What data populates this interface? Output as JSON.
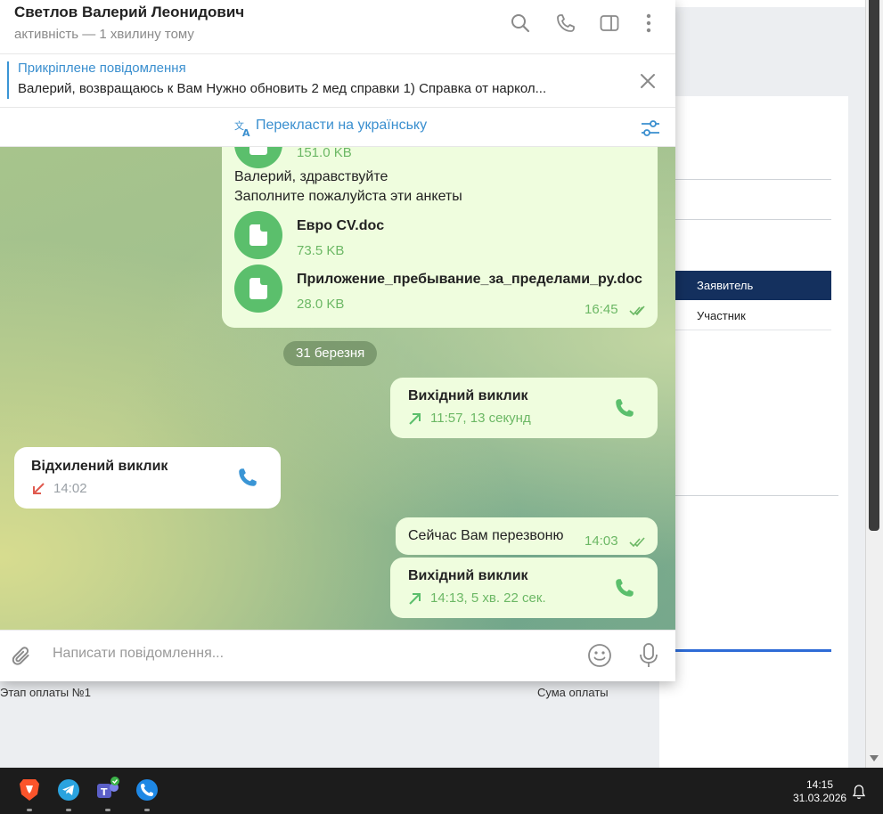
{
  "background_app": {
    "header_col": "Заявитель",
    "row_value": "Участник",
    "label_stage": "Этап оплаты №1",
    "label_sum": "Сума оплаты"
  },
  "telegram": {
    "contact_name": "Светлов Валерий Леонидович",
    "contact_status": "активність — 1 хвилину тому",
    "pinned_title": "Прикріплене повідомлення",
    "pinned_text": "Валерий, возвращаюсь к Вам  Нужно обновить 2 мед справки 1) Справка от наркол...",
    "translate_label": "Перекласти на українську",
    "messages": {
      "partial_file_size": "151.0 KB",
      "greeting_line1": "Валерий, здравствуйте",
      "greeting_line2": "Заполните пожалуйста эти анкеты",
      "file1_name": "Евро CV.doc",
      "file1_size": "73.5 KB",
      "file2_name": "Приложение_пребывание_за_пределами_ру.doc",
      "file2_size": "28.0 KB",
      "file_msg_time": "16:45",
      "date_divider": "31 березня",
      "call1_title": "Вихідний виклик",
      "call1_detail": "11:57, 13 секунд",
      "call2_title": "Відхилений виклик",
      "call2_detail": "14:02",
      "text_msg": "Сейчас Вам перезвоню",
      "text_msg_time": "14:03",
      "call3_title": "Вихідний виклик",
      "call3_detail": "14:13, 5 хв. 22 сек."
    },
    "composer_placeholder": "Написати повідомлення..."
  },
  "taskbar": {
    "time": "14:15",
    "date": "31.03.2026",
    "apps": [
      "brave-browser",
      "telegram",
      "teams",
      "phone-app"
    ]
  },
  "colors": {
    "accent_blue": "#3a8fcf",
    "bubble_out": "#effdde",
    "green": "#5bbf6c",
    "declined_red": "#e05a4f"
  }
}
